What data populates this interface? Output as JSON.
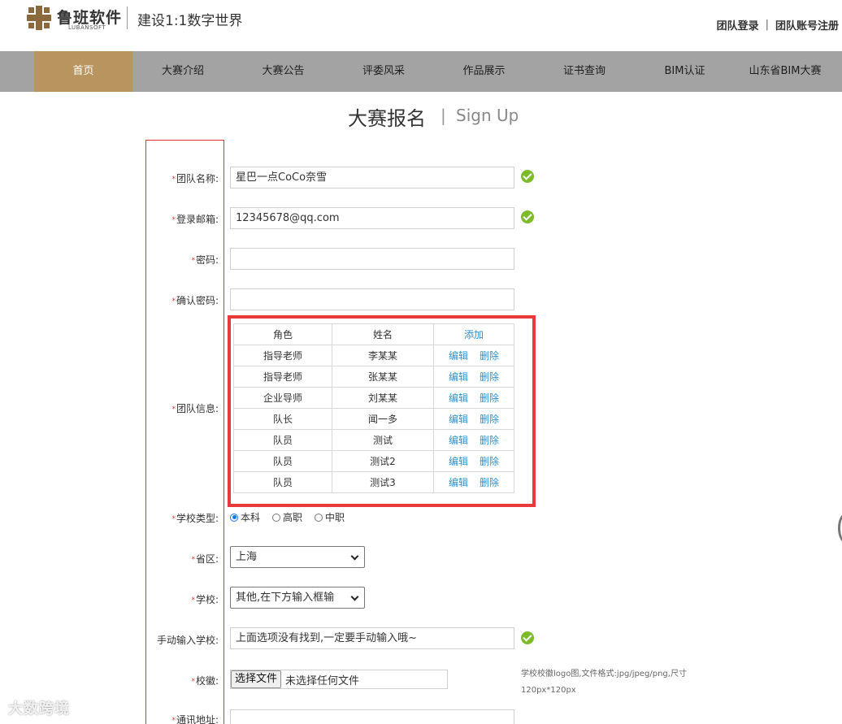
{
  "header": {
    "logo_cn": "鲁班软件",
    "logo_en": "LUBANSOFT",
    "slogan": "建设1:1数字世界",
    "login_link": "团队登录",
    "separator": "|",
    "register_link": "团队账号注册"
  },
  "nav": {
    "items": [
      "首页",
      "大赛介绍",
      "大赛公告",
      "评委风采",
      "作品展示",
      "证书查询",
      "BIM认证",
      "山东省BIM大赛"
    ],
    "active_index": 0
  },
  "title": {
    "cn": "大赛报名",
    "sep": "|",
    "en": "Sign Up"
  },
  "form": {
    "required_mark": "*",
    "team_name": {
      "label": "团队名称:",
      "value": "星巴一点CoCo奈雪"
    },
    "email": {
      "label": "登录邮箱:",
      "value": "12345678@qq.com"
    },
    "password": {
      "label": "密码:",
      "value": ""
    },
    "confirm_password": {
      "label": "确认密码:",
      "value": ""
    },
    "team_info": {
      "label": "团队信息:",
      "headers": [
        "角色",
        "姓名",
        "添加"
      ],
      "edit_label": "编辑",
      "delete_label": "删除",
      "rows": [
        {
          "role": "指导老师",
          "name": "李某某"
        },
        {
          "role": "指导老师",
          "name": "张某某"
        },
        {
          "role": "企业导师",
          "name": "刘某某"
        },
        {
          "role": "队长",
          "name": "闻一多"
        },
        {
          "role": "队员",
          "name": "测试"
        },
        {
          "role": "队员",
          "name": "测试2"
        },
        {
          "role": "队员",
          "name": "测试3"
        }
      ]
    },
    "school_type": {
      "label": "学校类型:",
      "options": [
        "本科",
        "高职",
        "中职"
      ],
      "selected": "本科"
    },
    "province": {
      "label": "省区:",
      "value": "上海"
    },
    "school": {
      "label": "学校:",
      "value": "其他,在下方输入框输"
    },
    "manual_school": {
      "label": "手动输入学校:",
      "value": "上面选项没有找到,一定要手动输入哦~"
    },
    "badge": {
      "label": "校徽:",
      "button": "选择文件",
      "status": "未选择任何文件",
      "hint": "学校校徽logo图,文件格式:jpg/jpeg/png,尺寸120px*120px"
    },
    "address": {
      "label": "通讯地址:"
    }
  },
  "watermark": "大数跨境"
}
